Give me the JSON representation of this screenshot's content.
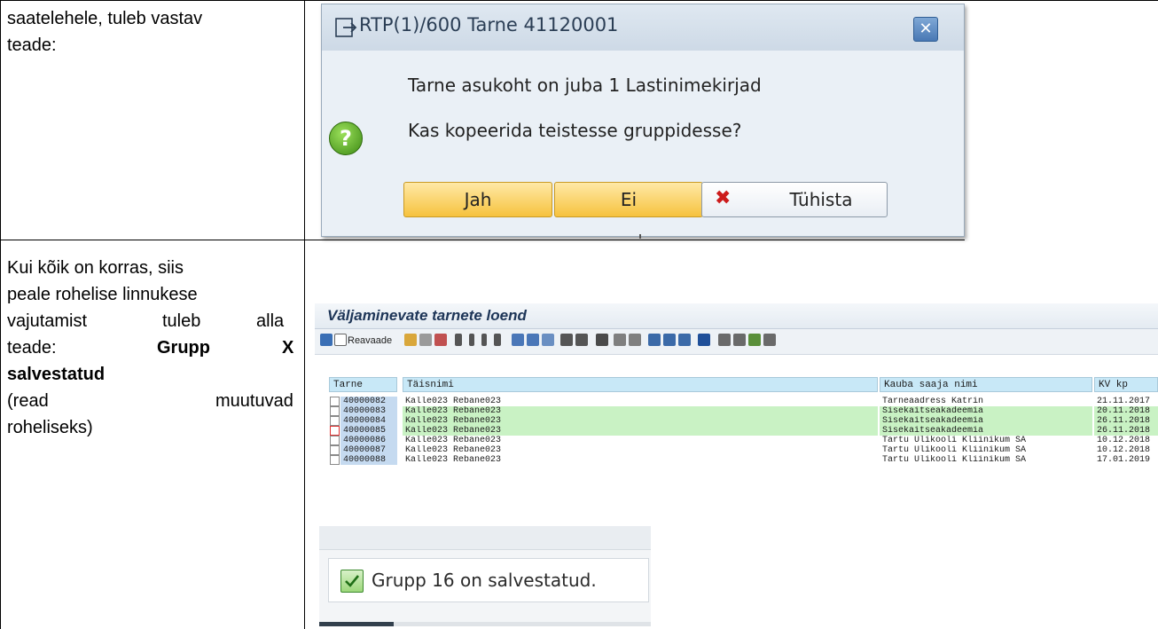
{
  "left_column": {
    "row1_line1": "saatelehele, tuleb vastav",
    "row1_line2": "teade:",
    "row2_line1": "Kui kõik on korras, siis",
    "row2_line2": "peale rohelise linnukese",
    "row2_line3_a": "vajutamist",
    "row2_line3_b": "tuleb",
    "row2_line3_c": "alla",
    "row2_line4_a": "teade:",
    "row2_line4_b": "Grupp",
    "row2_line4_c": "X",
    "row2_line5": "salvestatud",
    "row2_line6_a": "(read",
    "row2_line6_b": "muutuvad",
    "row2_line7": "roheliseks)"
  },
  "dialog": {
    "title": "RTP(1)/600 Tarne 41120001",
    "close_label": "✕",
    "message_line1": "Tarne asukoht on juba 1 Lastinimekirjad",
    "message_line2": "Kas kopeerida teistesse gruppidesse?",
    "help_glyph": "?",
    "btn_yes": "Jah",
    "btn_no": "Ei",
    "btn_cancel": "Tühista",
    "cancel_glyph": "✖"
  },
  "list": {
    "title": "Väljaminevate tarnete loend",
    "toolbar_label": "Reavaade",
    "headers": {
      "tarne": "Tarne",
      "taisnimi": "Täisnimi",
      "kauba_saaja": "Kauba saaja nimi",
      "kv_kp": "KV kp"
    },
    "rows": [
      {
        "tarne": "40000082",
        "nimi": "Kalle023 Rebane023",
        "saaja": "Tarneaadress Katrin",
        "kp": "21.11.2017",
        "green": false
      },
      {
        "tarne": "40000083",
        "nimi": "Kalle023 Rebane023",
        "saaja": "Sisekaitseakadeemia",
        "kp": "20.11.2018",
        "green": true
      },
      {
        "tarne": "40000084",
        "nimi": "Kalle023 Rebane023",
        "saaja": "Sisekaitseakadeemia",
        "kp": "26.11.2018",
        "green": true
      },
      {
        "tarne": "40000085",
        "nimi": "Kalle023 Rebane023",
        "saaja": "Sisekaitseakadeemia",
        "kp": "26.11.2018",
        "green": true
      },
      {
        "tarne": "40000086",
        "nimi": "Kalle023 Rebane023",
        "saaja": "Tartu Ülikooli Kliinikum SA",
        "kp": "10.12.2018",
        "green": false
      },
      {
        "tarne": "40000087",
        "nimi": "Kalle023 Rebane023",
        "saaja": "Tartu Ülikooli Kliinikum SA",
        "kp": "10.12.2018",
        "green": false
      },
      {
        "tarne": "40000088",
        "nimi": "Kalle023 Rebane023",
        "saaja": "Tartu Ülikooli Kliinikum SA",
        "kp": "17.01.2019",
        "green": false
      }
    ]
  },
  "status": {
    "message": "Grupp 16 on salvestatud.",
    "check_glyph": "✔"
  },
  "colors": {
    "row_green": "#c9f2c4",
    "header_blue": "#c8e8f7",
    "tarne_cell_blue": "#c5daf0",
    "button_yellow": "#f6c23e"
  }
}
